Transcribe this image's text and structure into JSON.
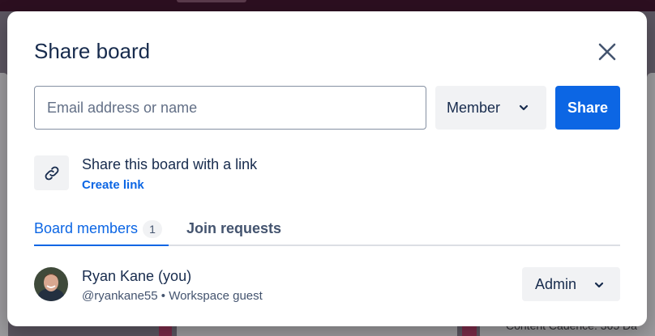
{
  "backdrop": {
    "peek_right_1": "Content Cadence: 365 Da"
  },
  "modal": {
    "title": "Share board",
    "close_icon": "close-icon"
  },
  "invite": {
    "placeholder": "Email address or name",
    "value": "",
    "role_label": "Member",
    "share_label": "Share"
  },
  "link": {
    "icon": "link-icon",
    "text": "Share this board with a link",
    "create_label": "Create link"
  },
  "tabs": [
    {
      "label": "Board members",
      "count": "1",
      "active": true
    },
    {
      "label": "Join requests",
      "active": false
    }
  ],
  "members": [
    {
      "name": "Ryan Kane (you)",
      "meta": "@ryankane55 • Workspace guest",
      "role": "Admin"
    }
  ],
  "colors": {
    "accent": "#0c66e4",
    "text": "#172b4d",
    "subtle": "#44546f"
  }
}
